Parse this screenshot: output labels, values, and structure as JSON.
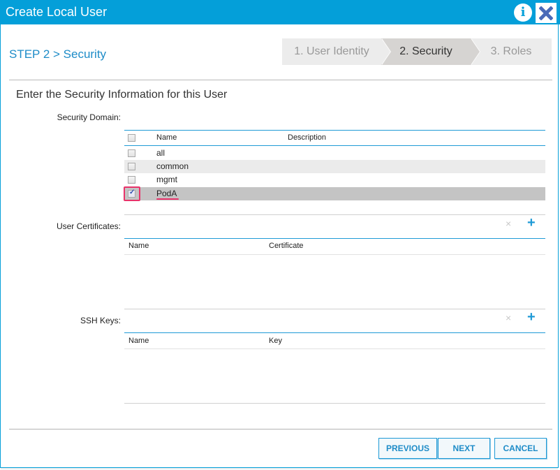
{
  "window": {
    "title": "Create Local User",
    "info_icon": "info-icon",
    "close_icon": "close-icon"
  },
  "wizard": {
    "step_title": "STEP 2 > Security",
    "steps": [
      {
        "label": "1. User Identity",
        "state": "inactive"
      },
      {
        "label": "2. Security",
        "state": "active"
      },
      {
        "label": "3. Roles",
        "state": "inactive"
      }
    ]
  },
  "form": {
    "heading": "Enter the Security Information for this User",
    "security_domain": {
      "label": "Security Domain:",
      "columns": [
        "Name",
        "Description"
      ],
      "rows": [
        {
          "name": "all",
          "description": "",
          "checked": false
        },
        {
          "name": "common",
          "description": "",
          "checked": false
        },
        {
          "name": "mgmt",
          "description": "",
          "checked": false
        },
        {
          "name": "PodA",
          "description": "",
          "checked": true
        }
      ]
    },
    "user_certificates": {
      "label": "User Certificates:",
      "columns": [
        "Name",
        "Certificate"
      ],
      "delete_icon": "×",
      "add_icon": "+"
    },
    "ssh_keys": {
      "label": "SSH Keys:",
      "columns": [
        "Name",
        "Key"
      ],
      "delete_icon": "×",
      "add_icon": "+"
    }
  },
  "footer": {
    "previous": "PREVIOUS",
    "next": "NEXT",
    "cancel": "CANCEL"
  },
  "colors": {
    "accent": "#049fd9",
    "highlight": "#e8336a"
  }
}
